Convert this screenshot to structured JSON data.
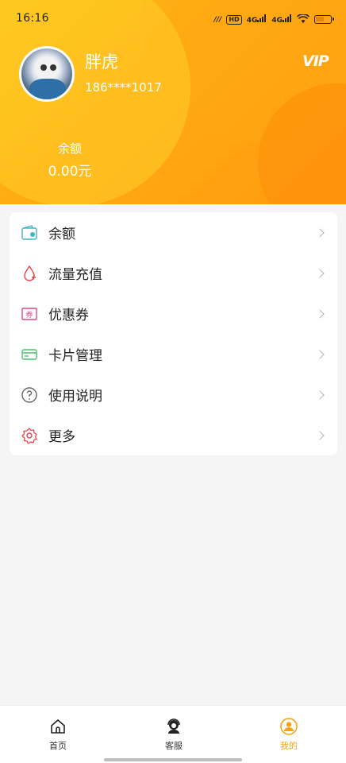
{
  "status_bar": {
    "time": "16:16",
    "network_1": "4G",
    "network_2": "4G",
    "hd": "HD"
  },
  "profile": {
    "name": "胖虎",
    "phone": "186****1017",
    "vip": "VIP",
    "balance_label": "余额",
    "balance_value": "0.00元"
  },
  "menu": {
    "items": [
      {
        "label": "余额",
        "icon": "wallet-icon"
      },
      {
        "label": "流量充值",
        "icon": "drop-plus-icon"
      },
      {
        "label": "优惠券",
        "icon": "coupon-icon"
      },
      {
        "label": "卡片管理",
        "icon": "card-icon"
      },
      {
        "label": "使用说明",
        "icon": "help-icon"
      },
      {
        "label": "更多",
        "icon": "gear-icon"
      }
    ]
  },
  "tabbar": {
    "tabs": [
      {
        "label": "首页",
        "icon": "home-icon"
      },
      {
        "label": "客服",
        "icon": "customer-service-icon"
      },
      {
        "label": "我的",
        "icon": "user-icon",
        "active": true
      }
    ]
  },
  "colors": {
    "accent": "#f5a416",
    "header_start": "#ffc21a",
    "header_end": "#ff9b10"
  }
}
